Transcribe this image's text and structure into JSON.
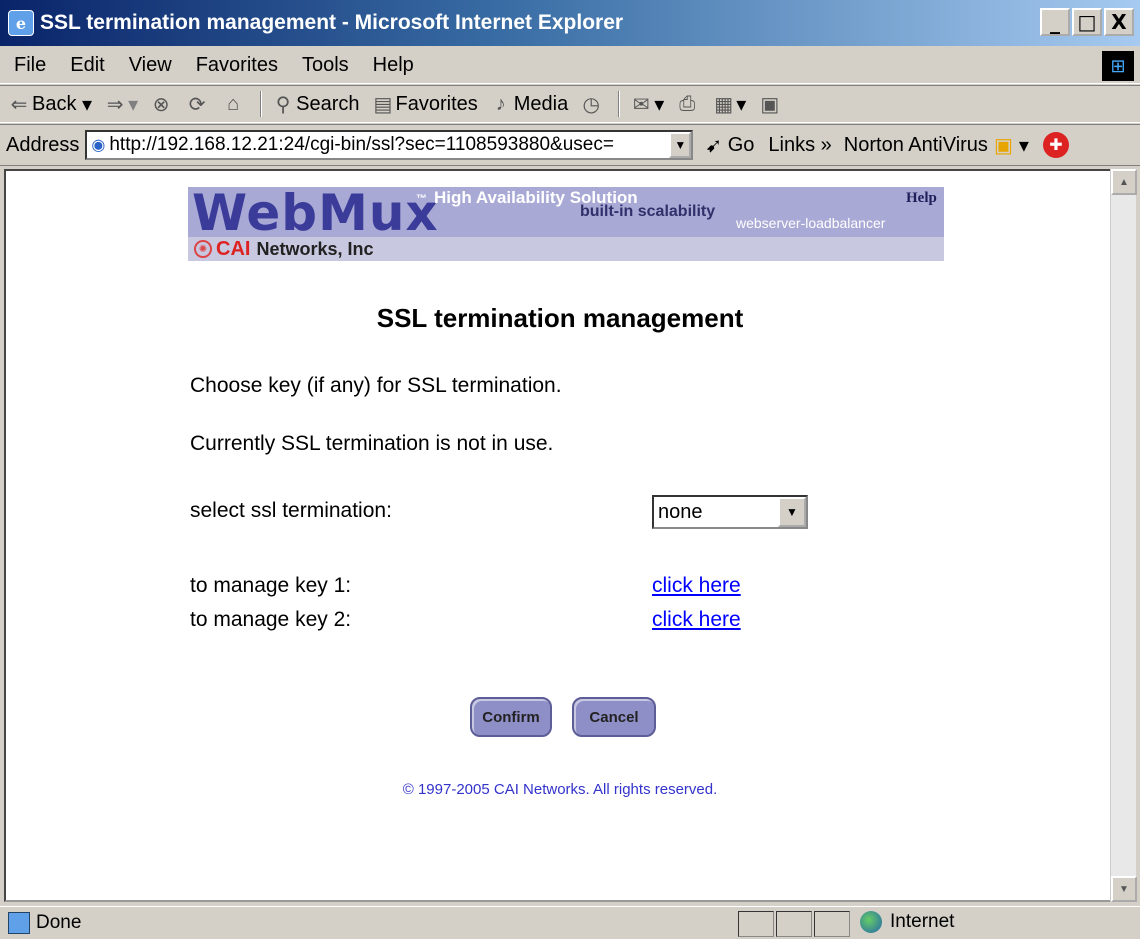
{
  "window": {
    "title": "SSL termination management - Microsoft Internet Explorer",
    "buttons": [
      "_",
      "□",
      "X"
    ]
  },
  "menu": [
    "File",
    "Edit",
    "View",
    "Favorites",
    "Tools",
    "Help"
  ],
  "toolbar": {
    "back": "Back",
    "search": "Search",
    "favorites": "Favorites",
    "media": "Media"
  },
  "address": {
    "label": "Address",
    "url": "http://192.168.12.21:24/cgi-bin/ssl?sec=1108593880&usec=",
    "go": "Go",
    "links": "Links",
    "norton": "Norton AntiVirus"
  },
  "banner": {
    "logo": "WebMux",
    "tm": "™",
    "tagline": "High Availability Solution",
    "sub": "built-in scalability",
    "loadbalancer": "webserver-loadbalancer",
    "help": "Help",
    "company_cai": "CAI",
    "company_rest": "Networks, Inc"
  },
  "page": {
    "title": "SSL termination management",
    "choose_text": "Choose key (if any) for SSL termination.",
    "status_text": "Currently SSL termination is not in use.",
    "select_label": "select ssl termination:",
    "select_value": "none",
    "key1_label": "to manage key 1:",
    "key2_label": "to manage key 2:",
    "link_text": "click here",
    "confirm": "Confirm",
    "cancel": "Cancel",
    "copyright": "© 1997-2005 CAI Networks. All rights reserved."
  },
  "statusbar": {
    "text": "Done",
    "zone": "Internet"
  }
}
